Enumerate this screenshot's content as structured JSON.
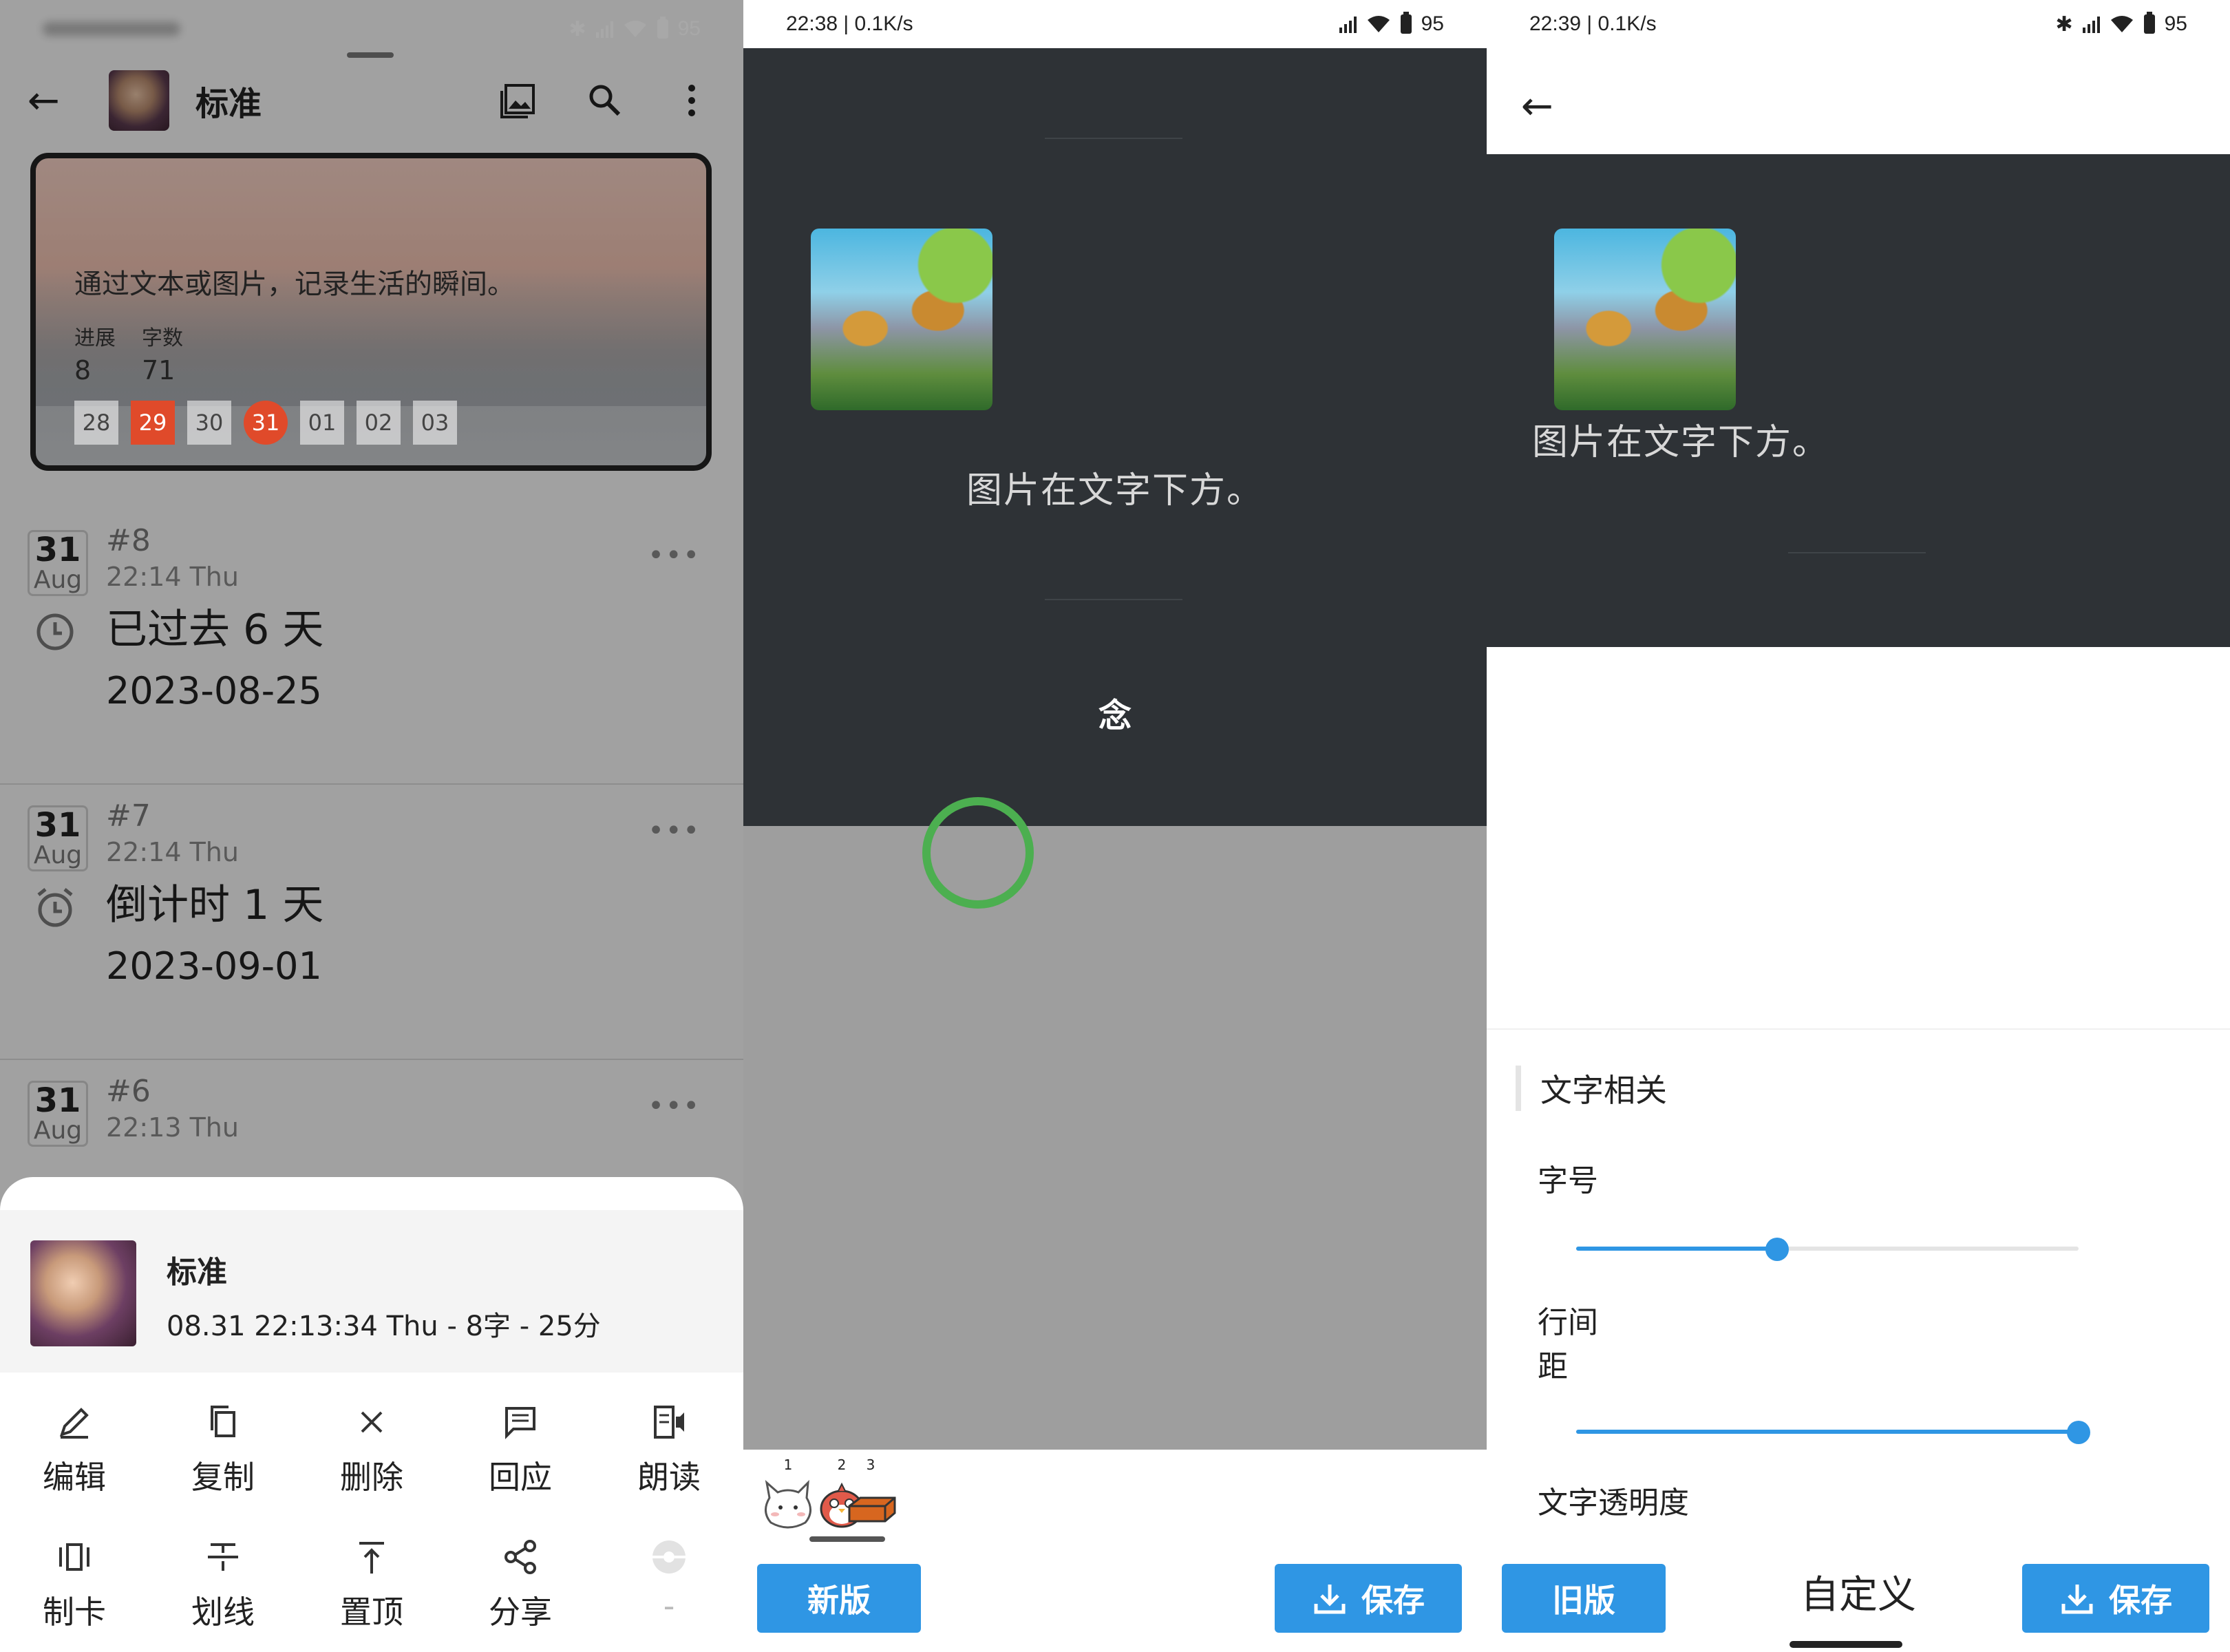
{
  "panel1": {
    "status": {
      "battery": "95"
    },
    "toolbar": {
      "title": "标准"
    },
    "card": {
      "quote": "通过文本或图片，记录生活的瞬间。",
      "stats": [
        {
          "label": "进展",
          "value": "8"
        },
        {
          "label": "字数",
          "value": "71"
        }
      ],
      "days": [
        "28",
        "29",
        "30",
        "31",
        "01",
        "02",
        "03"
      ]
    },
    "entries": [
      {
        "day": "31",
        "month": "Aug",
        "num": "#8",
        "time": "22:14 Thu",
        "head": "已过去 6 天",
        "sub": "2023-08-25",
        "icon": "clock-icon"
      },
      {
        "day": "31",
        "month": "Aug",
        "num": "#7",
        "time": "22:14 Thu",
        "head": "倒计时 1 天",
        "sub": "2023-09-01",
        "icon": "alarm-icon"
      },
      {
        "day": "31",
        "month": "Aug",
        "num": "#6",
        "time": "22:13 Thu"
      }
    ],
    "sheet": {
      "name": "标准",
      "meta": "08.31 22:13:34 Thu - 8字 - 25分",
      "actions": [
        {
          "label": "编辑",
          "icon": "pencil-icon"
        },
        {
          "label": "复制",
          "icon": "copy-icon"
        },
        {
          "label": "删除",
          "icon": "close-icon"
        },
        {
          "label": "回应",
          "icon": "comment-icon"
        },
        {
          "label": "朗读",
          "icon": "read-aloud-icon"
        },
        {
          "label": "制卡",
          "icon": "card-icon"
        },
        {
          "label": "划线",
          "icon": "strikethrough-icon"
        },
        {
          "label": "置顶",
          "icon": "pin-top-icon"
        },
        {
          "label": "分享",
          "icon": "share-icon"
        },
        {
          "label": "-",
          "icon": "ball-icon"
        }
      ]
    }
  },
  "panel2": {
    "status": {
      "time": "22:38 | 0.1K/s",
      "battery": "95"
    },
    "caption": "图片在文字下方。",
    "seal": "念",
    "stickers": [
      "1",
      "2",
      "3"
    ],
    "new_button": "新版",
    "save_button": "保存"
  },
  "panel3": {
    "status": {
      "time": "22:39 | 0.1K/s",
      "battery": "95"
    },
    "caption": "图片在文字下方。",
    "section_title": "文字相关",
    "font_size_label": "字号",
    "line_spacing_label_1": "行间",
    "line_spacing_label_2": "距",
    "opacity_label": "文字透明度",
    "font_size_value": 0.4,
    "line_spacing_value": 1.0,
    "old_button": "旧版",
    "custom_tab": "自定义",
    "save_button": "保存",
    "accent": "#2f96e4"
  }
}
